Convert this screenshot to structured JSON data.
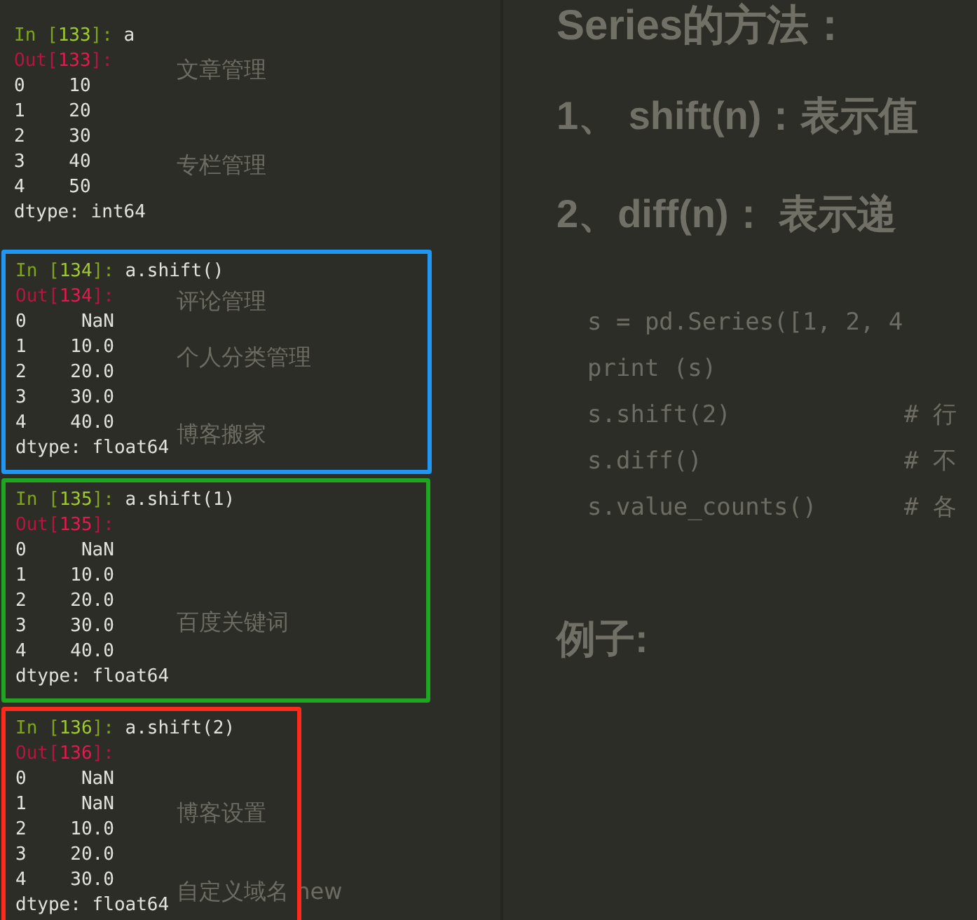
{
  "background_page": {
    "menu": [
      "文章管理",
      "专栏管理",
      "评论管理",
      "个人分类管理",
      "博客搬家",
      "百度关键词",
      "博客设置",
      "自定义域名 new"
    ],
    "heading": "Series的方法：",
    "points": [
      "1、 shift(n)：表示值",
      "2、diff(n)：  表示递"
    ],
    "code": [
      {
        "code": "s = pd.Series([1, 2, 4"
      },
      {
        "code": "print (s)"
      },
      {
        "code": "s.shift(2)",
        "comment": "# 行"
      },
      {
        "code": "s.diff()",
        "comment": "# 不"
      },
      {
        "code": "s.value_counts()",
        "comment": "# 各"
      }
    ],
    "example_heading": "例子:"
  },
  "console": [
    {
      "in_open": "In [",
      "in_number": "133",
      "in_close": "]: ",
      "code": "a",
      "out_open": "Out[",
      "out_number": "133",
      "out_close": "]:",
      "rows": [
        "0    10",
        "1    20",
        "2    30",
        "3    40",
        "4    50"
      ],
      "dtype": "dtype: int64"
    },
    {
      "in_open": "In [",
      "in_number": "134",
      "in_close": "]: ",
      "code": "a.shift()",
      "out_open": "Out[",
      "out_number": "134",
      "out_close": "]:",
      "color": "#2196f3",
      "rows": [
        "0     NaN",
        "1    10.0",
        "2    20.0",
        "3    30.0",
        "4    40.0"
      ],
      "dtype": "dtype: float64"
    },
    {
      "in_open": "In [",
      "in_number": "135",
      "in_close": "]: ",
      "code": "a.shift(1)",
      "out_open": "Out[",
      "out_number": "135",
      "out_close": "]:",
      "color": "#1fa51f",
      "rows": [
        "0     NaN",
        "1    10.0",
        "2    20.0",
        "3    30.0",
        "4    40.0"
      ],
      "dtype": "dtype: float64"
    },
    {
      "in_open": "In [",
      "in_number": "136",
      "in_close": "]: ",
      "code": "a.shift(2)",
      "out_open": "Out[",
      "out_number": "136",
      "out_close": "]:",
      "color": "#ff2a1a",
      "rows": [
        "0     NaN",
        "1     NaN",
        "2    10.0",
        "3    20.0",
        "4    30.0"
      ],
      "dtype": "dtype: float64"
    }
  ]
}
